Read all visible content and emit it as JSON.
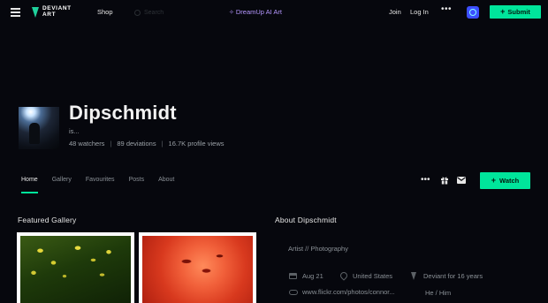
{
  "topbar": {
    "logo_line1": "DEVIANT",
    "logo_line2": "ART",
    "shop_label": "Shop",
    "search_placeholder": "Search",
    "dreamup_label": "DreamUp AI Art",
    "join_label": "Join",
    "login_label": "Log In",
    "more_label": "•••",
    "submit_label": "Submit"
  },
  "profile": {
    "name": "Dipschmidt",
    "tagline": "is...",
    "stats": {
      "watchers": "48 watchers",
      "deviations": "89 deviations",
      "views": "16.7K profile views",
      "separator": "|"
    }
  },
  "tabs": [
    {
      "label": "Home",
      "active": true
    },
    {
      "label": "Gallery"
    },
    {
      "label": "Favourites"
    },
    {
      "label": "Posts"
    },
    {
      "label": "About"
    }
  ],
  "actions": {
    "more_label": "•••",
    "watch_label": "Watch"
  },
  "featured": {
    "title": "Featured Gallery"
  },
  "about": {
    "title": "About Dipschmidt",
    "role": "Artist // Photography",
    "birthday": "Aug 21",
    "location": "United States",
    "deviant_for": "Deviant for 16 years",
    "website": "www.flickr.com/photos/connor...",
    "pronouns": "He / Him"
  },
  "colors": {
    "accent": "#00e59b",
    "dreamup": "#b597ff",
    "background": "#06070d"
  }
}
